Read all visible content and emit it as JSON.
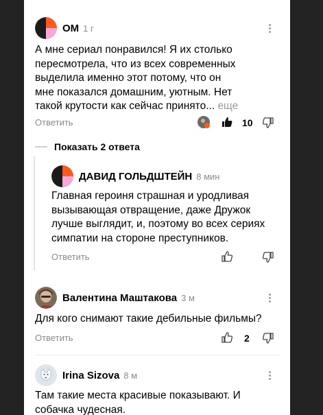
{
  "comments": [
    {
      "author": "ОМ",
      "time": "1 г",
      "text": "А мне сериал понравился! Я их столько пересмотрела, что из всех современных выделила именно этот потому, что он мне показался домашним, уютным. Нет такой крутости как сейчас принято...",
      "more": "еще",
      "reply_label": "Ответить",
      "likes": "10"
    },
    {
      "author": "ДАВИД ГОЛЬДШТЕЙН",
      "time": "8 мин",
      "text": "Главная героиня страшная и уродливая вызывающая отвращение, даже Дружок лучше выглядит, и, поэтому во всех сериях симпатии на стороне преступников.",
      "reply_label": "Ответить"
    },
    {
      "author": "Валентина Маштакова",
      "time": "3 м",
      "text": "Для кого снимают такие дебильные фильмы?",
      "reply_label": "Ответить",
      "likes": "2"
    },
    {
      "author": "Irina Sizova",
      "time": "8 м",
      "text": "Там такие места красивые показывают. И собачка чудесная."
    }
  ],
  "show_replies_label": "Показать 2 ответа",
  "icons": [
    "kebab-menu-icon",
    "thumbs-up-icon",
    "thumbs-down-icon",
    "reactor-avatar-icon"
  ],
  "colors": {
    "background": "#232323",
    "panel": "#ffffff",
    "muted": "#8a8a8a",
    "avatar_orange": "#ff5a1f",
    "avatar_pink": "#f7a8d8"
  }
}
